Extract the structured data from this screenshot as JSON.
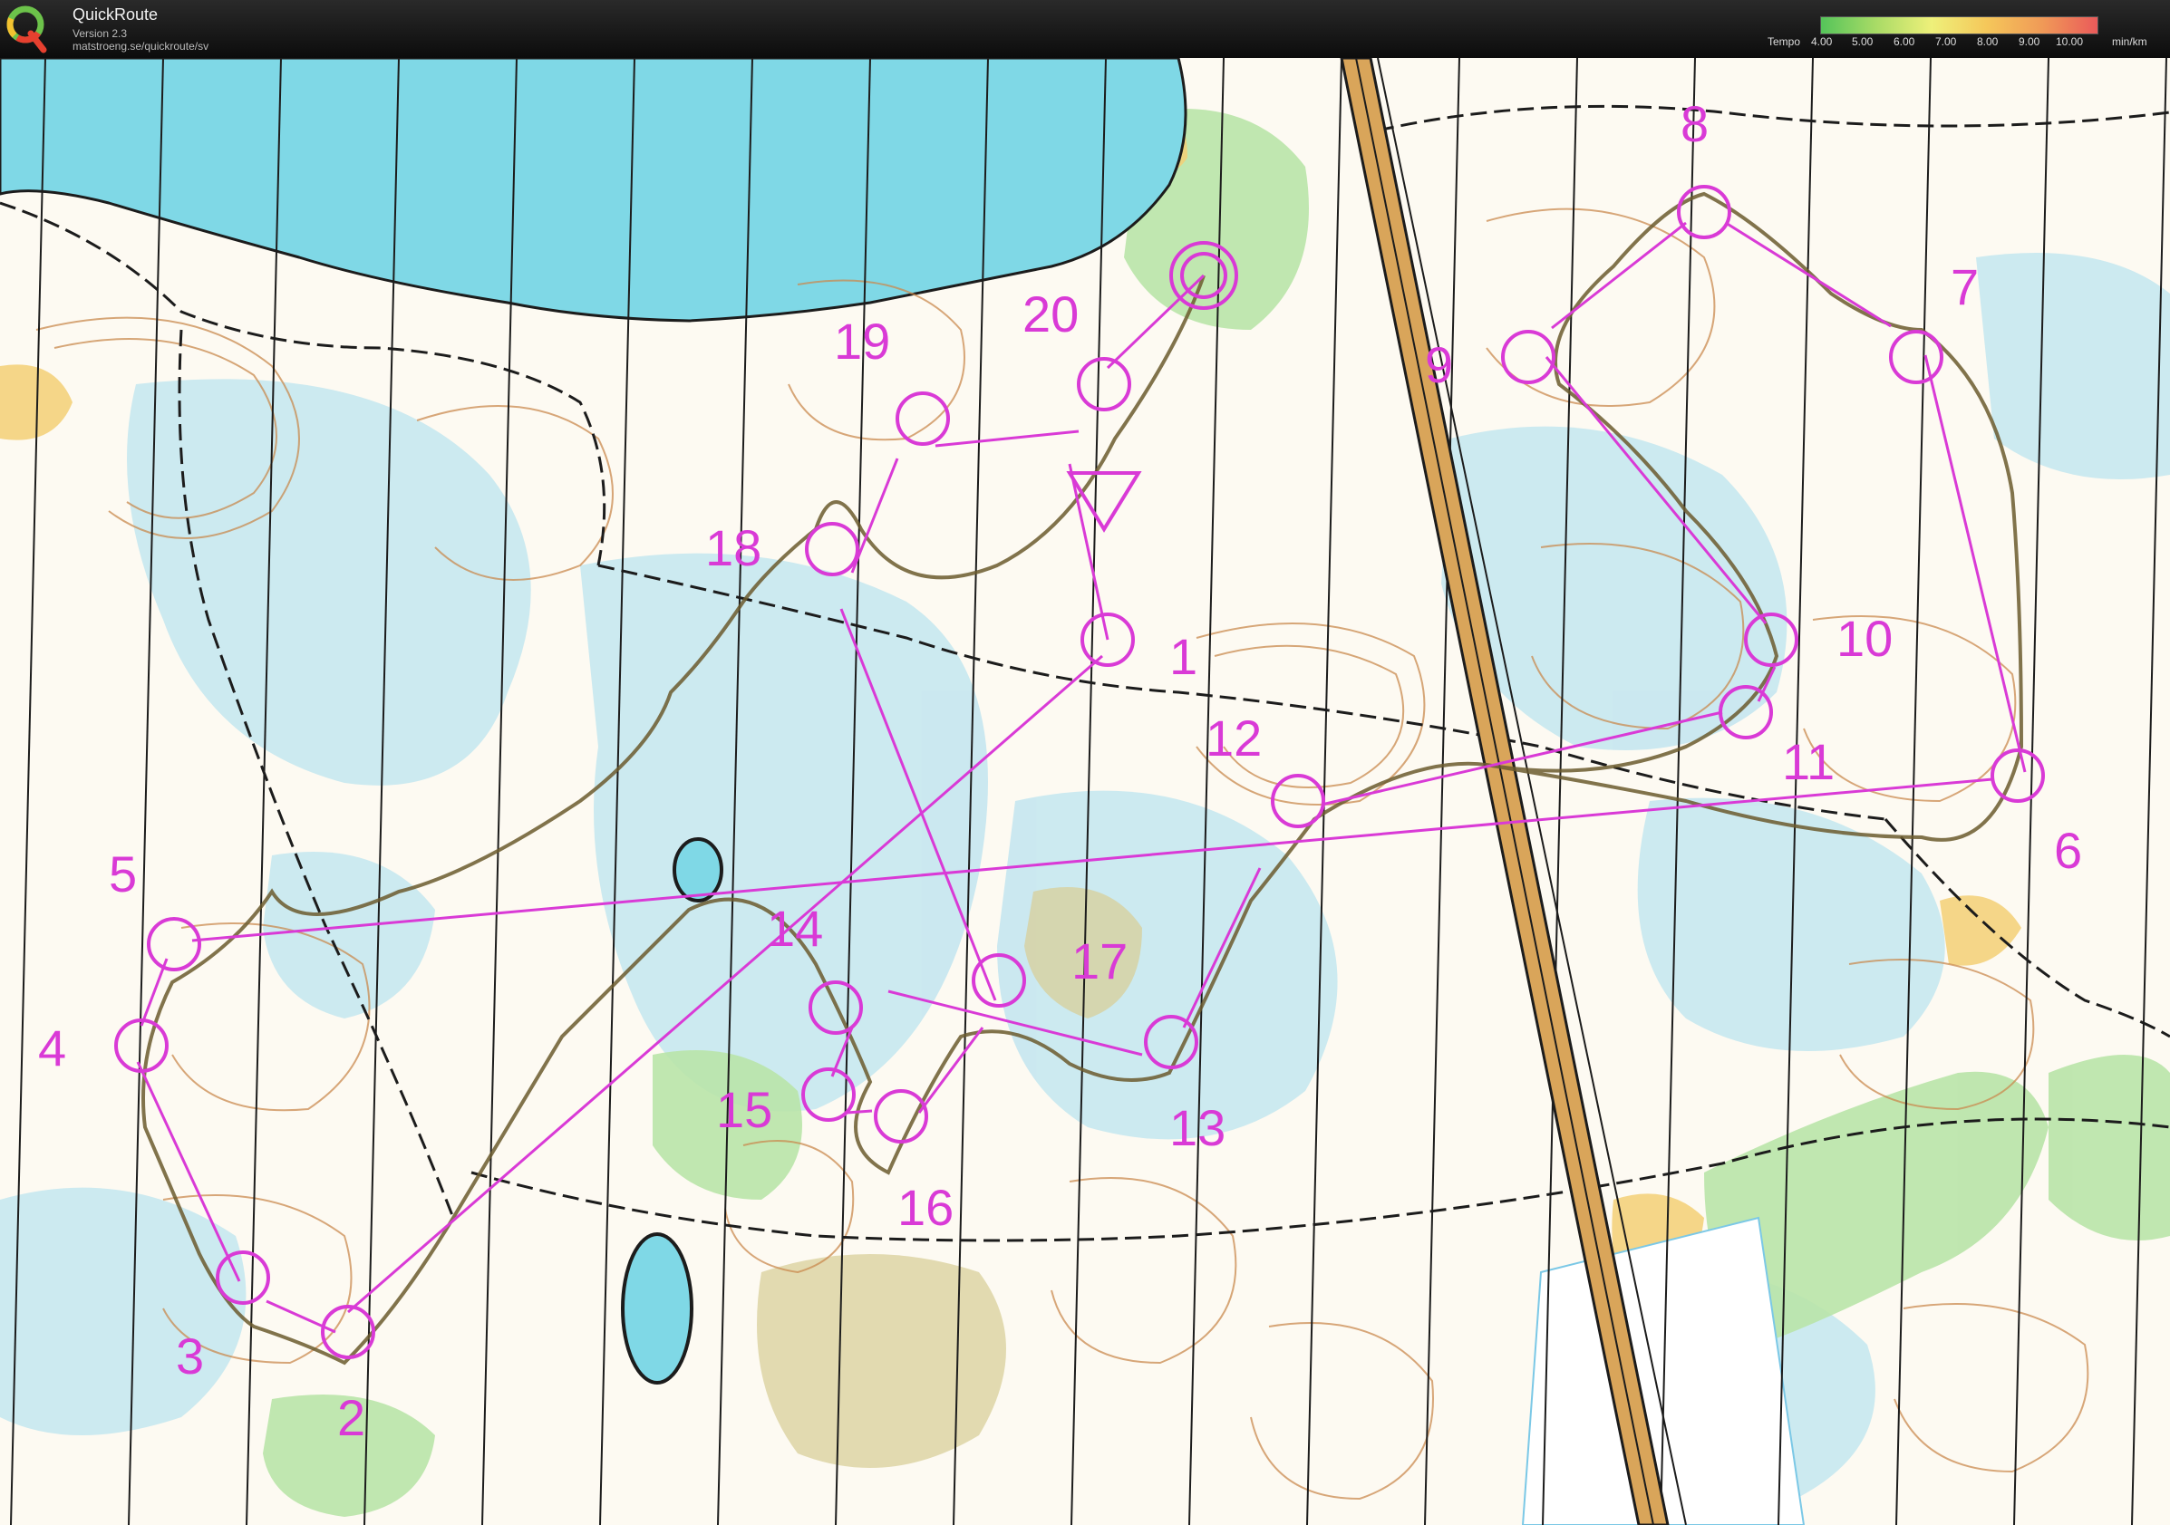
{
  "app": {
    "title": "QuickRoute",
    "version": "Version 2.3",
    "url": "matstroeng.se/quickroute/sv"
  },
  "tempo_legend": {
    "label": "Tempo",
    "ticks": [
      "4.00",
      "5.00",
      "6.00",
      "7.00",
      "8.00",
      "9.00",
      "10.00"
    ],
    "unit": "min/km",
    "colors": [
      "#55c45a",
      "#a9db66",
      "#eef07a",
      "#f5c75a",
      "#f09a57",
      "#ea5a5a"
    ]
  },
  "map": {
    "colors": {
      "water": "#7fd8e6",
      "forest": "#fdfaf2",
      "marsh": "#c3e6f0",
      "green": "#b9e4a8",
      "course": "#d93ad6",
      "route": "#6b5a2e",
      "road": "#d9a55a"
    },
    "controls": [
      "1",
      "2",
      "3",
      "4",
      "5",
      "6",
      "7",
      "8",
      "9",
      "10",
      "11",
      "12",
      "13",
      "14",
      "15",
      "16",
      "17",
      "18",
      "19",
      "20"
    ]
  }
}
